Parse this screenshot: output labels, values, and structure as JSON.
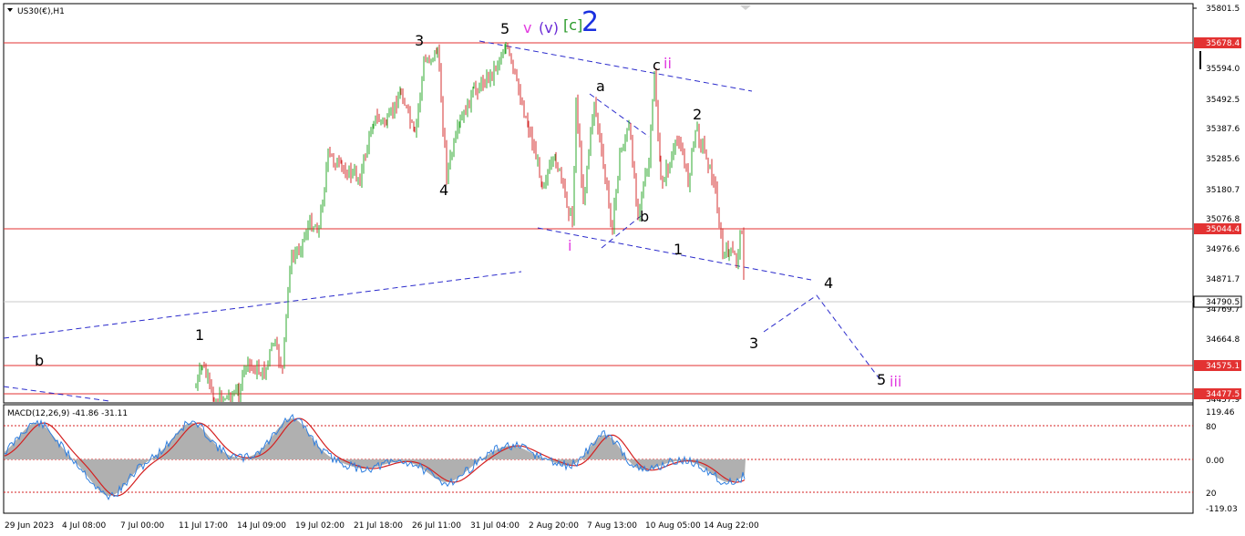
{
  "window": {
    "title": "US30(€),H1"
  },
  "wave_labels": {
    "main_5": "5",
    "v_label": "v",
    "v_paren_label": "(v)",
    "c_bracket_label": "[c]",
    "big_2_label": "2",
    "w3": "3",
    "w4": "4",
    "w1": "1",
    "wb_left": "b",
    "wa": "a",
    "wb_mid": "b",
    "wi": "i",
    "wc": "c",
    "wii": "ii",
    "w2_right": "2",
    "w1_right": "1",
    "proj_4": "4",
    "proj_3": "3",
    "proj_5": "5",
    "proj_iii": "iii"
  },
  "price_axis": {
    "labels": [
      "35801.5",
      "35594.0",
      "35492.5",
      "35387.6",
      "35285.6",
      "35180.7",
      "35076.8",
      "34976.6",
      "34871.7",
      "34769.7",
      "34664.8",
      "34457.9"
    ],
    "tagged_levels": [
      {
        "value": "35678.4",
        "color": "#e33232"
      },
      {
        "value": "35044.4",
        "color": "#e33232"
      },
      {
        "value": "34790.5",
        "color": "#ffffff"
      },
      {
        "value": "34575.1",
        "color": "#e33232"
      },
      {
        "value": "34477.5",
        "color": "#e33232"
      }
    ]
  },
  "time_axis": {
    "labels": [
      "29 Jun 2023",
      "4 Jul 08:00",
      "7 Jul 00:00",
      "11 Jul 17:00",
      "14 Jul 09:00",
      "19 Jul 02:00",
      "21 Jul 18:00",
      "26 Jul 11:00",
      "31 Jul 04:00",
      "2 Aug 20:00",
      "7 Aug 13:00",
      "10 Aug 05:00",
      "14 Aug 22:00"
    ]
  },
  "macd": {
    "label": "MACD(12,26,9) -41.86 -31.11",
    "axis_labels": [
      "119.46",
      "80",
      "0.00",
      "20",
      "-119.03"
    ]
  },
  "colors": {
    "up_candle": "#2fa82f",
    "down_candle": "#d43030",
    "level_line": "#e33232",
    "trend_line": "#2b2bcc",
    "magenta": "#e23be0",
    "green": "#2a9a2a",
    "blue": "#1a30e0",
    "macd_hist": "#b0b0b0",
    "macd_signal": "#d42020",
    "macd_line": "#2f7fe0"
  }
}
